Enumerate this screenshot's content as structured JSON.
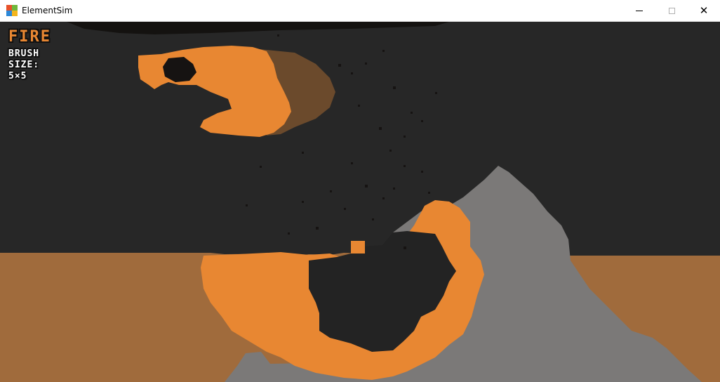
{
  "window": {
    "title": "ElementSim",
    "app_icon": "windows-app-icon",
    "controls": {
      "minimize_icon": "minimize-icon",
      "maximize_icon": "maximize-icon",
      "close_icon": "close-icon"
    }
  },
  "hud": {
    "element_name": "FIRE",
    "brush_label": "BRUSH SIZE:",
    "brush_value": "5×5"
  },
  "palette": {
    "background": "#272727",
    "fire": "#e88732",
    "smoke": "#161312",
    "ember_dark": "#6b4a2c",
    "dirt": "#a06b3c",
    "stone": "#7b7978"
  }
}
